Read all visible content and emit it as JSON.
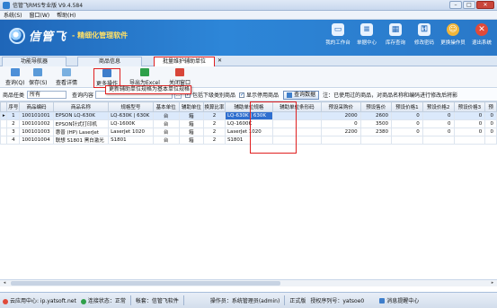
{
  "window": {
    "title": "信管飞RMS专业版 V9.4.584"
  },
  "menu": [
    "系统(S)",
    "窗口(W)",
    "帮助(H)"
  ],
  "brand": {
    "name": "信管飞",
    "slogan": "- 精细化管理软件"
  },
  "topnav": [
    {
      "label": "我的工作台",
      "icon": "monitor-icon"
    },
    {
      "label": "单据中心",
      "icon": "document-icon"
    },
    {
      "label": "库存查询",
      "icon": "warehouse-icon"
    },
    {
      "label": "修改密码",
      "icon": "key-icon"
    },
    {
      "label": "更换操作员",
      "icon": "user-icon"
    },
    {
      "label": "退出系统",
      "icon": "exit-icon"
    }
  ],
  "tabs": [
    "功能导航器",
    "商品信息",
    "批量维护辅助单位"
  ],
  "toolbar": {
    "query": "查询(Q)",
    "save": "保存(S)",
    "detail": "查看详情",
    "more": "更多操作",
    "export": "导出为Excel",
    "close": "关闭窗口"
  },
  "dropdown_item": "更新辅助单位规格为基本单位规格",
  "filter": {
    "category_label": "商品任类",
    "category_value": "所有",
    "query_label": "查询内容",
    "query_placeholder": "",
    "include_lower": "包括下级类别商品",
    "show_disabled": "显示停用商品",
    "query_btn": "查询数据",
    "note": "注：已使用过的商品，对商品名称和编码进行修改后将影响..."
  },
  "table": {
    "columns": [
      "序号",
      "商品编码",
      "商品名称",
      "规格型号",
      "基本单位",
      "辅助单位",
      "换算比率",
      "辅助单位规格",
      "辅助单位条形码",
      "预设采购价",
      "预设售价",
      "预设价格1",
      "预设价格2",
      "预设价格3",
      "预"
    ],
    "rows": [
      [
        "1",
        "100101001",
        "EPSON LQ-630K",
        "LQ-630K | 630K",
        "台",
        "箱",
        "2",
        "LQ-630K | 630K",
        "",
        "2000",
        "2600",
        "0",
        "0",
        "0",
        "0"
      ],
      [
        "2",
        "100101002",
        "EPSON针式打印机",
        "LQ-1600K",
        "台",
        "箱",
        "2",
        "LQ-1600K",
        "",
        "0",
        "3500",
        "0",
        "0",
        "0",
        "0"
      ],
      [
        "3",
        "100101003",
        "惠普 (HP) LaserJet",
        "LaserJet 1020",
        "台",
        "箱",
        "2",
        "LaserJet 1020",
        "",
        "2200",
        "2380",
        "0",
        "0",
        "0",
        "0"
      ],
      [
        "4",
        "100101004",
        "联想 S1801 黑白激光",
        "S1801",
        "台",
        "箱",
        "2",
        "S1801",
        "",
        "",
        "",
        "",
        "",
        "",
        ""
      ]
    ]
  },
  "status": {
    "cloud": "云应用中心: ip.yatsoft.net",
    "conn": "连接状态：正常",
    "acct": "帐套：信管飞软件",
    "operator": "操作员：系统管理员(admin)",
    "edition": "正式版",
    "serial": "授权序列号：yatsoe0",
    "tips": "消息提醒中心"
  },
  "colors": {
    "accent": "#2a78c8",
    "highlight": "#e02020",
    "selected": "#2f6fcf"
  }
}
